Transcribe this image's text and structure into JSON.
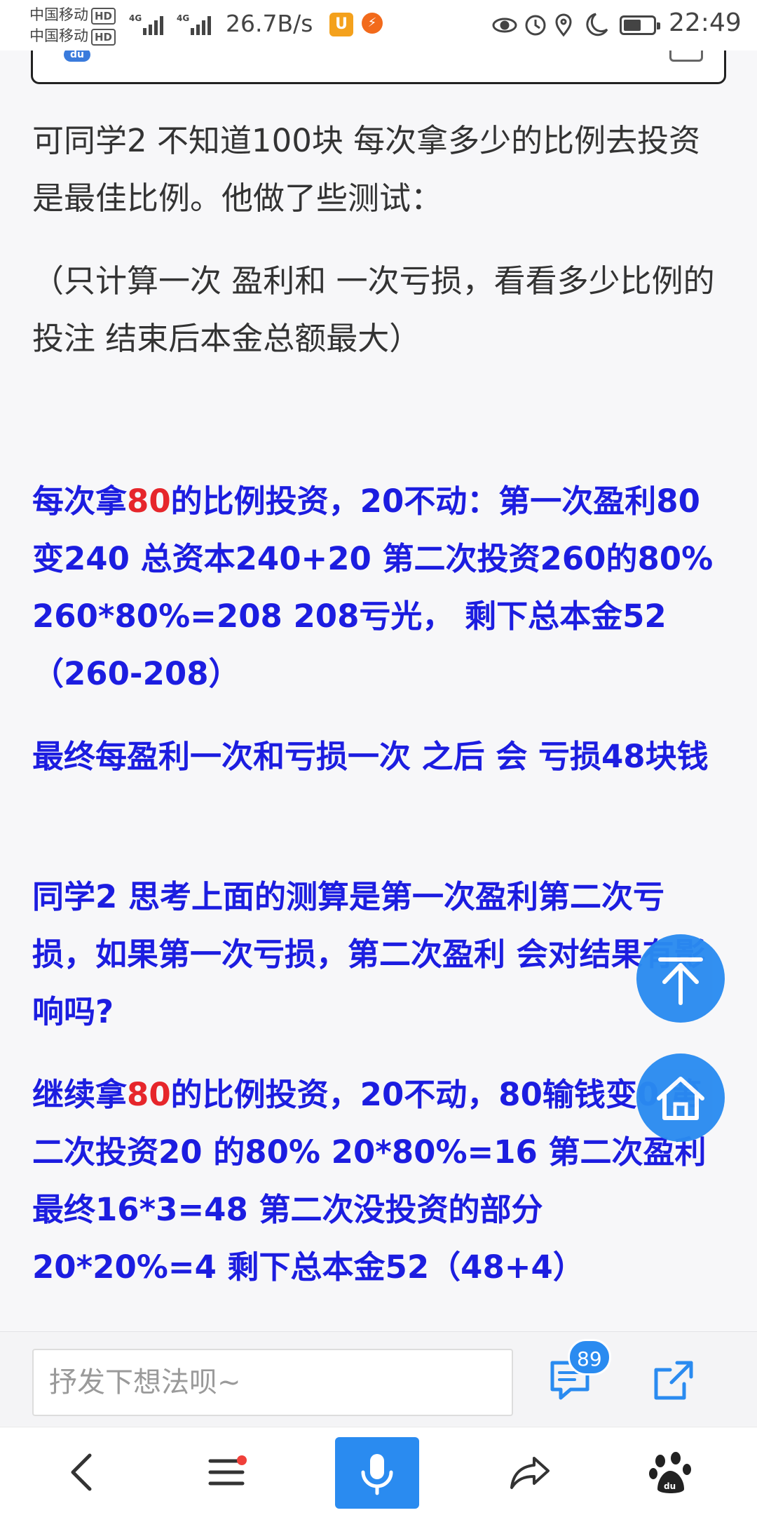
{
  "status_bar": {
    "carrier_1": "中国移动",
    "carrier_2": "中国移动",
    "hd": "HD",
    "network": "4G",
    "speed": "26.7B/s",
    "time": "22:49"
  },
  "article": {
    "intro_1": "可同学2 不知道100块 每次拿多少的比例去投资 是最佳比例。他做了些测试：",
    "intro_2": "（只计算一次 盈利和 一次亏损，看看多少比例的投注 结束后本金总额最大）",
    "case1_prefix": "每次拿",
    "case1_red": "80",
    "case1_rest": "的比例投资，20不动：第一次盈利80变240 总资本240+20 第二次投资260的80% 260*80%=208 208亏光， 剩下总本金52（260-208）",
    "conclusion": "最终每盈利一次和亏损一次 之后 会 亏损48块钱",
    "question": "同学2 思考上面的测算是第一次盈利第二次亏损，如果第一次亏损，第二次盈利 会对结果有影响吗?",
    "case2_prefix": "继续拿",
    "case2_red": "80",
    "case2_rest": "的比例投资，20不动，80输钱变0 第二次投资20 的80% 20*80%=16 第二次盈利最终16*3=48 第二次没投资的部分20*20%=4 剩下总本金52（48+4）"
  },
  "comment_bar": {
    "placeholder": "抒发下想法呗~",
    "comment_count": "89"
  },
  "icons": {
    "back_to_top": "arrow-up-icon",
    "home": "home-icon",
    "comment": "comment-icon",
    "share": "share-icon",
    "nav_back": "chevron-left-icon",
    "nav_menu": "menu-icon",
    "nav_mic": "microphone-icon",
    "nav_forward": "forward-icon",
    "nav_baidu": "baidu-paw-icon"
  },
  "colors": {
    "accent": "#2a8bf0",
    "article_blue": "#1c1de0",
    "highlight_red": "#e6262b"
  }
}
